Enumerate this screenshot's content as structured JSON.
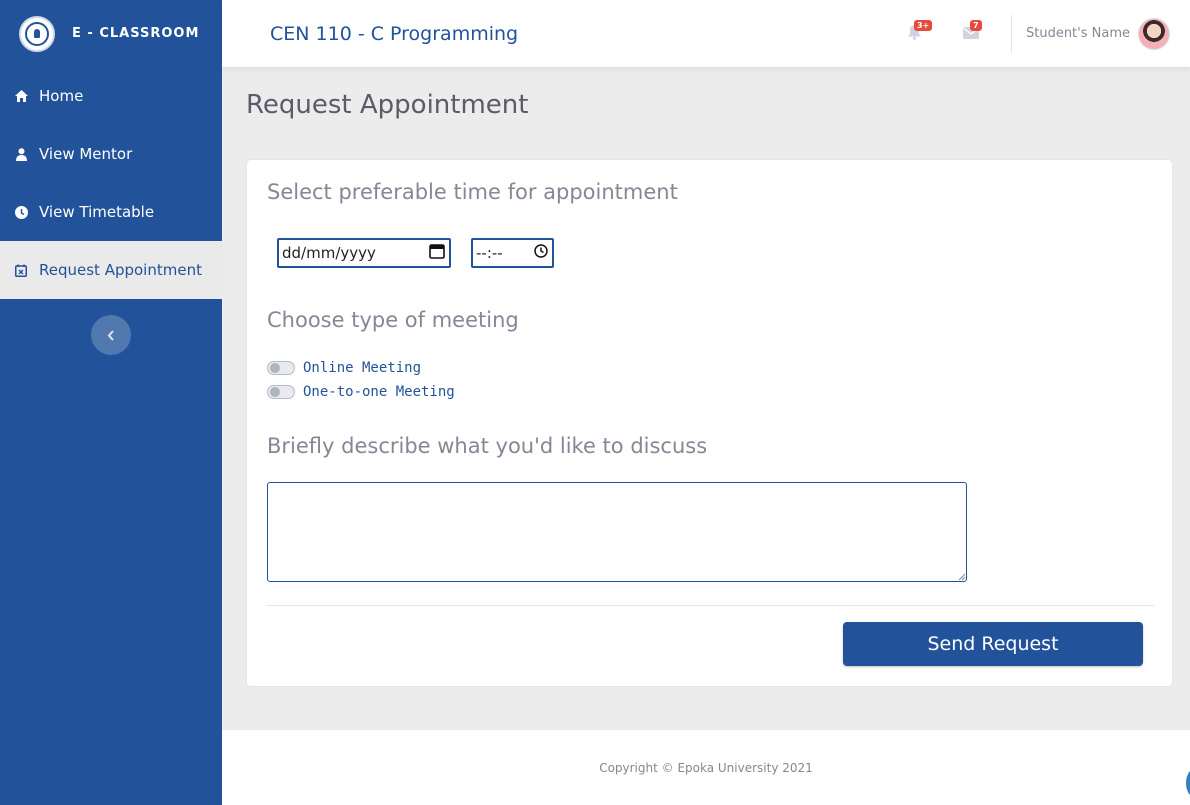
{
  "brand": {
    "name": "E - CLASSROOM",
    "logo_icon": "university-seal-icon"
  },
  "sidebar": {
    "items": [
      {
        "label": "Home",
        "icon": "home-icon",
        "active": false
      },
      {
        "label": "View Mentor",
        "icon": "user-icon",
        "active": false
      },
      {
        "label": "View Timetable",
        "icon": "clock-icon",
        "active": false
      },
      {
        "label": "Request Appointment",
        "icon": "calendar-x-icon",
        "active": true
      }
    ],
    "toggle_icon": "chevron-left-icon"
  },
  "topbar": {
    "course_title": "CEN 110 - C Programming",
    "alerts_badge": "3+",
    "messages_badge": "7",
    "user_name": "Student's Name"
  },
  "page": {
    "title": "Request Appointment"
  },
  "form": {
    "time_section_title": "Select preferable time for appointment",
    "date_placeholder": "dd/mm/yyyy",
    "time_placeholder": "--:--",
    "meeting_section_title": "Choose type of meeting",
    "meeting_options": [
      {
        "label": "Online Meeting",
        "checked": false
      },
      {
        "label": "One-to-one Meeting",
        "checked": false
      }
    ],
    "describe_section_title": "Briefly describe what you'd like to discuss",
    "description_value": "",
    "submit_label": "Send Request"
  },
  "footer": {
    "copyright": "Copyright © Epoka University 2021"
  },
  "colors": {
    "primary": "#22539a",
    "page_bg": "#ececec",
    "badge": "#e74a3b",
    "muted_text": "#858796"
  }
}
